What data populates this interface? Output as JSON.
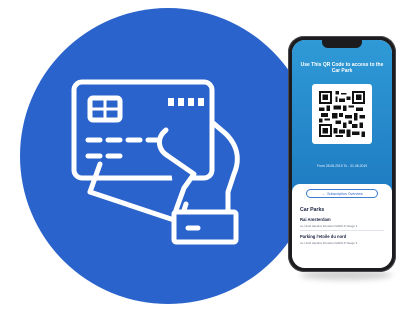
{
  "colors": {
    "circle": "#2b63cc",
    "phone_header": "#1f7cc2",
    "text_dark": "#1a2240"
  },
  "illustration": {
    "icon": "hand-holding-credit-card-icon"
  },
  "phone": {
    "qr_title": "Use This QR Code to access to the Car Park",
    "validity": "From 28.08.2019 To - 31.08.2019",
    "subscription_button": "Subscription Overview",
    "section_title": "Car Parks",
    "car_parks": [
      {
        "name": "Rai Amsterdam",
        "address": "Av. Hindl Haudins Woudens MAPA 37 Etage 3"
      },
      {
        "name": "Parking l'etoile du nord",
        "address": "Av. Hindl Haudins Woudens MAPA 37 Etage 3"
      }
    ]
  }
}
